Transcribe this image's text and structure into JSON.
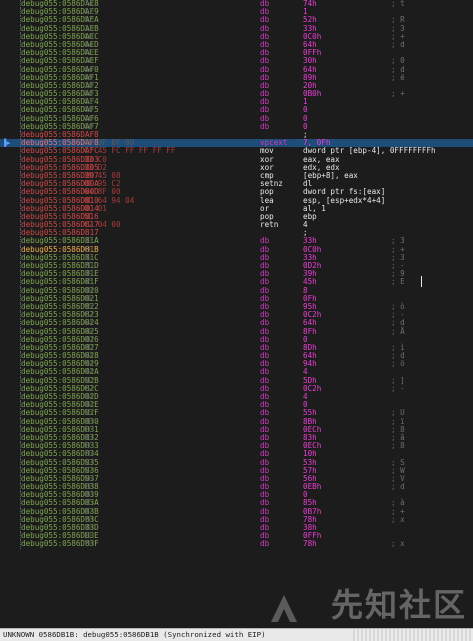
{
  "rows": [
    {
      "addr": "debug055:0586DAE8",
      "bytes": "74",
      "mn": "db",
      "op": "74h",
      "cm": "; t"
    },
    {
      "addr": "debug055:0586DAE9",
      "bytes": "01",
      "mn": "db",
      "op": "1",
      "cm": ""
    },
    {
      "addr": "debug055:0586DAEA",
      "bytes": "52",
      "mn": "db",
      "op": "52h",
      "cm": "; R"
    },
    {
      "addr": "debug055:0586DAEB",
      "bytes": "33",
      "mn": "db",
      "op": "33h",
      "cm": "; 3"
    },
    {
      "addr": "debug055:0586DAEC",
      "bytes": "C0",
      "mn": "db",
      "op": "0C0h",
      "cm": "; +"
    },
    {
      "addr": "debug055:0586DAED",
      "bytes": "64",
      "mn": "db",
      "op": "64h",
      "cm": "; d"
    },
    {
      "addr": "debug055:0586DAEE",
      "bytes": "FF",
      "mn": "db",
      "op": "0FFh",
      "cm": ""
    },
    {
      "addr": "debug055:0586DAEF",
      "bytes": "30",
      "mn": "db",
      "op": "30h",
      "cm": "; 0"
    },
    {
      "addr": "debug055:0586DAF0",
      "bytes": "64",
      "mn": "db",
      "op": "64h",
      "cm": "; d"
    },
    {
      "addr": "debug055:0586DAF1",
      "bytes": "89",
      "mn": "db",
      "op": "89h",
      "cm": "; ë"
    },
    {
      "addr": "debug055:0586DAF2",
      "bytes": "20",
      "mn": "db",
      "op": "20h",
      "cm": ""
    },
    {
      "addr": "debug055:0586DAF3",
      "bytes": "B0",
      "mn": "db",
      "op": "0B0h",
      "cm": "; +"
    },
    {
      "addr": "debug055:0586DAF4",
      "bytes": "01",
      "mn": "db",
      "op": "1",
      "cm": ""
    },
    {
      "addr": "debug055:0586DAF5",
      "bytes": "00",
      "mn": "db",
      "op": "0",
      "cm": ""
    },
    {
      "addr": "debug055:0586DAF6",
      "bytes": "00",
      "mn": "db",
      "op": "0",
      "cm": ""
    },
    {
      "addr": "debug055:0586DAF7",
      "bytes": "00",
      "mn": "db",
      "op": "0",
      "cm": ""
    },
    {
      "addr": "debug055:0586DAF8",
      "bytes": "",
      "mn": "",
      "op": ";",
      "cm": "",
      "kind": "code"
    },
    {
      "addr": "debug055:0586DAF8",
      "bytes": "0F 3F 0F 00",
      "mn": "vpcext",
      "op": "7, 0Fh",
      "cm": "",
      "kind": "hl"
    },
    {
      "addr": "debug055:0586DAFC",
      "bytes": "C7 45 FC FF FF FF FF",
      "mn": "mov",
      "op": "dword ptr [ebp-4], 0FFFFFFFFh",
      "cm": "",
      "kind": "code"
    },
    {
      "addr": "debug055:0586DB03",
      "bytes": "33 C0",
      "mn": "xor",
      "op": "eax, eax",
      "cm": "",
      "kind": "code"
    },
    {
      "addr": "debug055:0586DB05",
      "bytes": "33 D2",
      "mn": "xor",
      "op": "edx, edx",
      "cm": "",
      "kind": "code"
    },
    {
      "addr": "debug055:0586DB07",
      "bytes": "39 45 08",
      "mn": "cmp",
      "op": "[ebp+8], eax",
      "cm": "",
      "kind": "code"
    },
    {
      "addr": "debug055:0586DB0A",
      "bytes": "0F 95 C2",
      "mn": "setnz",
      "op": "dl",
      "cm": "",
      "kind": "code"
    },
    {
      "addr": "debug055:0586DB0D",
      "bytes": "64 8F 00",
      "mn": "pop",
      "op": "dword ptr fs:[eax]",
      "cm": "",
      "kind": "code"
    },
    {
      "addr": "debug055:0586DB10",
      "bytes": "8D 64 94 04",
      "mn": "lea",
      "op": "esp, [esp+edx*4+4]",
      "cm": "",
      "kind": "code"
    },
    {
      "addr": "debug055:0586DB14",
      "bytes": "0C 01",
      "mn": "or",
      "op": "al, 1",
      "cm": "",
      "kind": "code"
    },
    {
      "addr": "debug055:0586DB16",
      "bytes": "5D",
      "mn": "pop",
      "op": "ebp",
      "cm": "",
      "kind": "code"
    },
    {
      "addr": "debug055:0586DB17",
      "bytes": "C2 04 00",
      "mn": "retn",
      "op": "4",
      "cm": "",
      "kind": "code"
    },
    {
      "addr": "debug055:0586DB17",
      "bytes": "",
      "mn": "",
      "op": ";",
      "cm": "",
      "kind": "code"
    },
    {
      "addr": "debug055:0586DB1A",
      "bytes": "33",
      "mn": "db",
      "op": "33h",
      "cm": "; 3"
    },
    {
      "addr": "debug055:0586DB1B",
      "bytes": "C0",
      "mn": "db",
      "op": "0C0h",
      "cm": "; +",
      "kind": "cur"
    },
    {
      "addr": "debug055:0586DB1C",
      "bytes": "33",
      "mn": "db",
      "op": "33h",
      "cm": "; 3"
    },
    {
      "addr": "debug055:0586DB1D",
      "bytes": "2D",
      "mn": "db",
      "op": "0D2h",
      "cm": "; -"
    },
    {
      "addr": "debug055:0586DB1E",
      "bytes": "39",
      "mn": "db",
      "op": "39h",
      "cm": "; 9"
    },
    {
      "addr": "debug055:0586DB1F",
      "bytes": "45",
      "mn": "db",
      "op": "45h",
      "cm": "; E"
    },
    {
      "addr": "debug055:0586DB20",
      "bytes": "08",
      "mn": "db",
      "op": "8",
      "cm": ""
    },
    {
      "addr": "debug055:0586DB21",
      "bytes": "0F",
      "mn": "db",
      "op": "0Fh",
      "cm": ""
    },
    {
      "addr": "debug055:0586DB22",
      "bytes": "95",
      "mn": "db",
      "op": "95h",
      "cm": "; ò"
    },
    {
      "addr": "debug055:0586DB23",
      "bytes": "C2",
      "mn": "db",
      "op": "0C2h",
      "cm": "; -"
    },
    {
      "addr": "debug055:0586DB24",
      "bytes": "64",
      "mn": "db",
      "op": "64h",
      "cm": "; d"
    },
    {
      "addr": "debug055:0586DB25",
      "bytes": "8F",
      "mn": "db",
      "op": "8Fh",
      "cm": "; Å"
    },
    {
      "addr": "debug055:0586DB26",
      "bytes": "00",
      "mn": "db",
      "op": "0",
      "cm": ""
    },
    {
      "addr": "debug055:0586DB27",
      "bytes": "8D",
      "mn": "db",
      "op": "8Dh",
      "cm": "; ì"
    },
    {
      "addr": "debug055:0586DB28",
      "bytes": "64",
      "mn": "db",
      "op": "64h",
      "cm": "; d"
    },
    {
      "addr": "debug055:0586DB29",
      "bytes": "94",
      "mn": "db",
      "op": "94h",
      "cm": "; ö"
    },
    {
      "addr": "debug055:0586DB2A",
      "bytes": "04",
      "mn": "db",
      "op": "4",
      "cm": ""
    },
    {
      "addr": "debug055:0586DB2B",
      "bytes": "5D",
      "mn": "db",
      "op": "5Dh",
      "cm": "; ]"
    },
    {
      "addr": "debug055:0586DB2C",
      "bytes": "C2",
      "mn": "db",
      "op": "0C2h",
      "cm": "; -"
    },
    {
      "addr": "debug055:0586DB2D",
      "bytes": "04",
      "mn": "db",
      "op": "4",
      "cm": ""
    },
    {
      "addr": "debug055:0586DB2E",
      "bytes": "00",
      "mn": "db",
      "op": "0",
      "cm": ""
    },
    {
      "addr": "debug055:0586DB2F",
      "bytes": "55",
      "mn": "db",
      "op": "55h",
      "cm": "; U"
    },
    {
      "addr": "debug055:0586DB30",
      "bytes": "8B",
      "mn": "db",
      "op": "8Bh",
      "cm": "; ï"
    },
    {
      "addr": "debug055:0586DB31",
      "bytes": "EC",
      "mn": "db",
      "op": "0ECh",
      "cm": "; 8"
    },
    {
      "addr": "debug055:0586DB32",
      "bytes": "83",
      "mn": "db",
      "op": "83h",
      "cm": "; â"
    },
    {
      "addr": "debug055:0586DB33",
      "bytes": "EC",
      "mn": "db",
      "op": "0ECh",
      "cm": "; 8"
    },
    {
      "addr": "debug055:0586DB34",
      "bytes": "10",
      "mn": "db",
      "op": "10h",
      "cm": ""
    },
    {
      "addr": "debug055:0586DB35",
      "bytes": "53",
      "mn": "db",
      "op": "53h",
      "cm": "; S"
    },
    {
      "addr": "debug055:0586DB36",
      "bytes": "57",
      "mn": "db",
      "op": "57h",
      "cm": "; W"
    },
    {
      "addr": "debug055:0586DB37",
      "bytes": "56",
      "mn": "db",
      "op": "56h",
      "cm": "; V"
    },
    {
      "addr": "debug055:0586DB38",
      "bytes": "EB",
      "mn": "db",
      "op": "0EBh",
      "cm": "; d"
    },
    {
      "addr": "debug055:0586DB39",
      "bytes": "00",
      "mn": "db",
      "op": "0",
      "cm": ""
    },
    {
      "addr": "debug055:0586DB3A",
      "bytes": "85",
      "mn": "db",
      "op": "85h",
      "cm": "; à"
    },
    {
      "addr": "debug055:0586DB3B",
      "bytes": "B7",
      "mn": "db",
      "op": "0B7h",
      "cm": "; +"
    },
    {
      "addr": "debug055:0586DB3C",
      "bytes": "78",
      "mn": "db",
      "op": "78h",
      "cm": "; x"
    },
    {
      "addr": "debug055:0586DB3D",
      "bytes": "38",
      "mn": "db",
      "op": "38h",
      "cm": ""
    },
    {
      "addr": "debug055:0586DB3E",
      "bytes": "FF",
      "mn": "db",
      "op": "0FFh",
      "cm": ""
    },
    {
      "addr": "debug055:0586DB3F",
      "bytes": "78",
      "mn": "db",
      "op": "78h",
      "cm": "; x"
    }
  ],
  "status_text": "UNKNOWN 0586DB1B: debug055:0586DB1B (Synchronized with EIP)",
  "watermark": "先知社区",
  "colors": {
    "background": "#1c1c1c",
    "address": "#7fa64f",
    "code_address": "#d04848",
    "directive": "#d13bc4",
    "highlight": "#1e4d79",
    "cursor_address": "#f2b24a"
  },
  "icons": {
    "eip_arrow": "eip-arrow-icon",
    "watermark_logo": "watermark-logo-icon"
  }
}
